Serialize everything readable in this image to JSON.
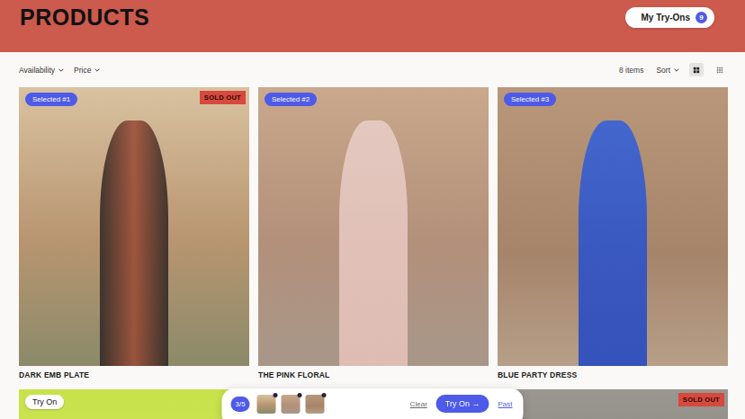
{
  "header": {
    "title": "PRODUCTS",
    "tryons_button": {
      "label": "My Try-Ons",
      "count": "9"
    }
  },
  "filters": [
    {
      "label": "Availability"
    },
    {
      "label": "Price"
    }
  ],
  "toolbar": {
    "count": "8 items",
    "sort": "Sort",
    "views": [
      {
        "kind": "grid",
        "selected": true
      },
      {
        "kind": "dense",
        "selected": false
      }
    ]
  },
  "products": [
    {
      "name": "DARK EMB PLATE",
      "badge": "Selected #1",
      "selected": true,
      "status": "SOLD OUT"
    },
    {
      "name": "THE PINK FLORAL",
      "badge": "Selected #2",
      "selected": true,
      "status": null
    },
    {
      "name": "BLUE PARTY DRESS",
      "badge": "Selected #3",
      "selected": true,
      "status": null
    },
    {
      "name": null,
      "badge": "Try On",
      "selected": false,
      "status": null
    },
    {
      "name": null,
      "badge": null,
      "selected": false,
      "status": null
    },
    {
      "name": null,
      "badge": null,
      "selected": false,
      "status": "SOLD OUT"
    }
  ],
  "tray": {
    "count": "3/5",
    "clear": "Clear",
    "try_on": "Try On →",
    "past": "Past"
  }
}
